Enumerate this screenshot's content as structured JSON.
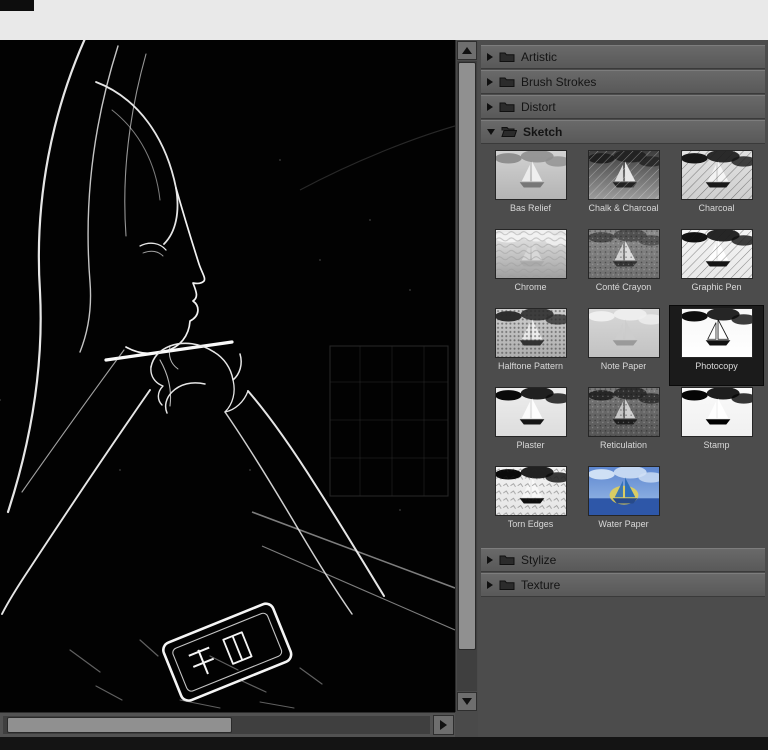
{
  "panel": {
    "categories": [
      {
        "label": "Artistic",
        "expanded": false
      },
      {
        "label": "Brush Strokes",
        "expanded": false
      },
      {
        "label": "Distort",
        "expanded": false
      },
      {
        "label": "Sketch",
        "expanded": true
      },
      {
        "label": "Stylize",
        "expanded": false
      },
      {
        "label": "Texture",
        "expanded": false
      }
    ],
    "sketch_filters": [
      "Bas Relief",
      "Chalk & Charcoal",
      "Charcoal",
      "Chrome",
      "Conté Crayon",
      "Graphic Pen",
      "Halftone Pattern",
      "Note Paper",
      "Photocopy",
      "Plaster",
      "Reticulation",
      "Stamp",
      "Torn Edges",
      "Water Paper"
    ],
    "selected_filter": "Photocopy"
  },
  "colors": {
    "panel_bg": "#4c4c4c",
    "header_text": "#141414",
    "thumb_label": "#d8d8d8",
    "selected_cell_bg": "#1b1b1b",
    "top_strip": "#e9e9e9",
    "bottom_bar": "#141414",
    "preview_bg": "#020202",
    "water_paper_blue": "#5d86cf",
    "water_paper_yellow": "#e9d34f"
  }
}
